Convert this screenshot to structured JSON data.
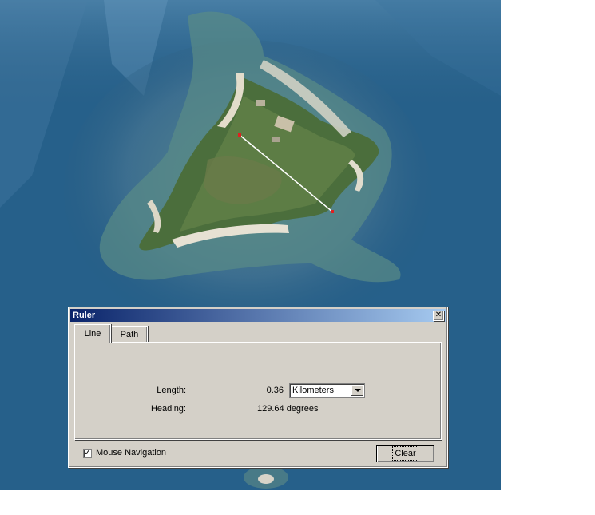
{
  "window": {
    "title": "Ruler",
    "close_glyph": "✕"
  },
  "tabs": {
    "line": "Line",
    "path": "Path"
  },
  "measurements": {
    "length_label": "Length:",
    "length_value": "0.36",
    "units_selected": "Kilometers",
    "heading_label": "Heading:",
    "heading_value": "129.64 degrees"
  },
  "options": {
    "mouse_navigation_label": "Mouse Navigation",
    "mouse_navigation_checked": true,
    "check_glyph": "✓"
  },
  "buttons": {
    "clear_label": "Clear"
  },
  "colors": {
    "ocean": "#245a82",
    "titlebar_start": "#0a246a",
    "titlebar_end": "#a6caf0",
    "dialog_bg": "#d4d0c8",
    "ruler_line": "#ffffff",
    "ruler_point": "#e02020"
  }
}
